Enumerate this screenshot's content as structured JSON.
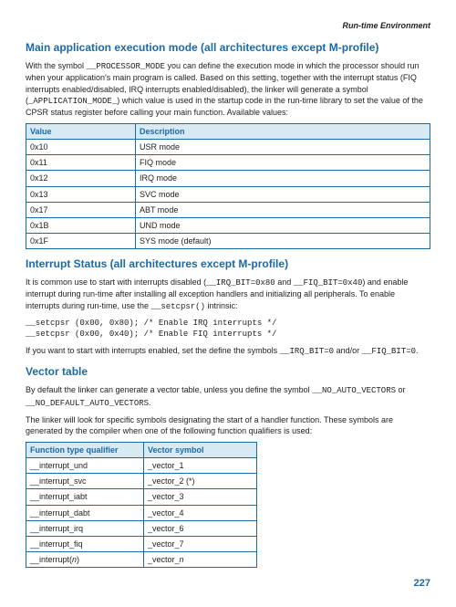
{
  "header": "Run-time Environment",
  "section1": {
    "title": "Main application execution mode (all architectures except M-profile)",
    "para_pre": "With the symbol ",
    "sym1": "__PROCESSOR_MODE",
    "para_mid1": " you can define the execution mode in which the processor should run when your application's main program is called. Based on this setting, together with the interrupt status (FIQ interrupts enabled/disabled, IRQ interrupts enabled/disabled), the linker will generate a symbol (",
    "sym2": "_APPLICATION_MODE_",
    "para_mid2": ") which value is used in the startup code in the run-time library to set the value of the CPSR status register before calling your main function. Available values:"
  },
  "table1": {
    "h1": "Value",
    "h2": "Description",
    "rows": [
      [
        "0x10",
        "USR mode"
      ],
      [
        "0x11",
        "FIQ mode"
      ],
      [
        "0x12",
        "IRQ mode"
      ],
      [
        "0x13",
        "SVC mode"
      ],
      [
        "0x17",
        "ABT mode"
      ],
      [
        "0x1B",
        "UND mode"
      ],
      [
        "0x1F",
        "SYS mode (default)"
      ]
    ]
  },
  "section2": {
    "title": "Interrupt Status (all architectures except M-profile)",
    "p1a": "It is common use to start with interrupts disabled (",
    "p1b": "__IRQ_BIT=0x80",
    "p1c": " and ",
    "p1d": "__FIQ_BIT=0x40",
    "p1e": ") and enable interrupt during run-time after installing all exception handlers and initializing all peripherals. To enable interrupts during run-time, use the ",
    "p1f": "__setcpsr()",
    "p1g": " intrinsic:",
    "code": "__setcpsr (0x00, 0x80); /* Enable IRQ interrupts */\n__setcpsr (0x00, 0x40); /* Enable FIQ interrupts */",
    "p2a": "If you want to start with interrupts enabled, set the define the symbols ",
    "p2b": "__IRQ_BIT=0",
    "p2c": " and/or ",
    "p2d": "__FIQ_BIT=0",
    "p2e": "."
  },
  "section3": {
    "title": "Vector table",
    "p1a": "By default the linker can generate a vector table, unless you define the symbol ",
    "p1b": "__NO_AUTO_VECTORS",
    "p1c": " or ",
    "p1d": "__NO_DEFAULT_AUTO_VECTORS",
    "p1e": ".",
    "p2": "The linker will look for specific symbols designating the start of a handler function. These symbols are generated by the compiler when one of the following function qualifiers is used:"
  },
  "table2": {
    "h1": "Function type qualifier",
    "h2": "Vector symbol",
    "rows": [
      [
        "__interrupt_und",
        "_vector_1"
      ],
      [
        "__interrupt_svc",
        "_vector_2 (*)"
      ],
      [
        "__interrupt_iabt",
        "_vector_3"
      ],
      [
        "__interrupt_dabt",
        "_vector_4"
      ],
      [
        "__interrupt_irq",
        "_vector_6"
      ],
      [
        "__interrupt_fiq",
        "_vector_7"
      ]
    ],
    "lastrow_a": "__interrupt(",
    "lastrow_b": "n",
    "lastrow_c": ")",
    "lastrow_d": "_vector_",
    "lastrow_e": "n"
  },
  "pagenum": "227"
}
